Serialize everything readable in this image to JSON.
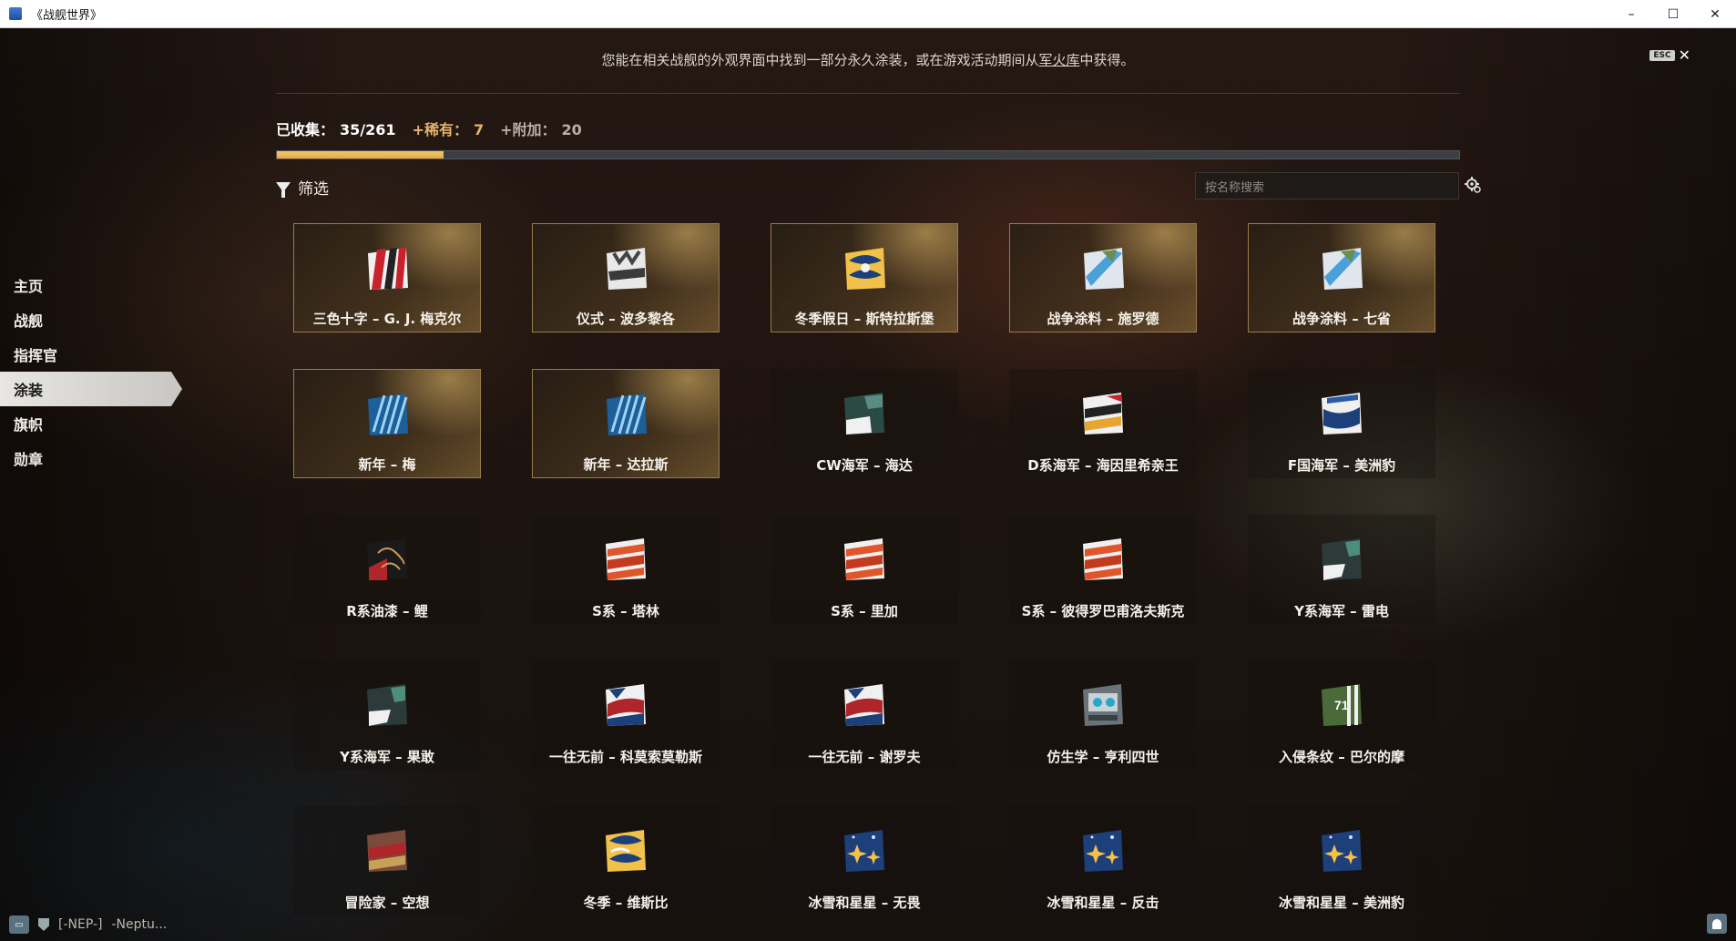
{
  "window": {
    "title": "《战舰世界》",
    "minimize": "–",
    "maximize": "☐",
    "close": "✕"
  },
  "header": {
    "esc_key": "ESC",
    "close_glyph": "✕",
    "info_prefix": "您能在相关战舰的外观界面中找到一部分永久涂装，或在游戏活动期间从",
    "info_link": "军火库",
    "info_suffix": "中获得。"
  },
  "stats": {
    "collected_label": "已收集：",
    "collected_value": "35/261",
    "rare_label": "+稀有：",
    "rare_value": "7",
    "extra_label": "+附加：",
    "extra_value": "20",
    "progress_fraction": 0.141
  },
  "filter": {
    "label": "筛选"
  },
  "search": {
    "placeholder": "按名称搜索"
  },
  "sidebar": {
    "items": [
      {
        "label": "主页"
      },
      {
        "label": "战舰"
      },
      {
        "label": "指挥官"
      },
      {
        "label": "涂装",
        "active": true
      },
      {
        "label": "旗帜"
      },
      {
        "label": "勋章"
      }
    ]
  },
  "camos": [
    {
      "name": "三色十字 – G. J. 梅克尔",
      "rare": true,
      "icon": "tricolor-cross-icon"
    },
    {
      "name": "仪式 – 波多黎各",
      "rare": true,
      "icon": "ceremony-icon"
    },
    {
      "name": "冬季假日 – 斯特拉斯堡",
      "rare": true,
      "icon": "winter-holiday-icon"
    },
    {
      "name": "战争涂料 – 施罗德",
      "rare": true,
      "icon": "war-paint-icon"
    },
    {
      "name": "战争涂料 – 七省",
      "rare": true,
      "icon": "war-paint-icon"
    },
    {
      "name": "新年 – 梅",
      "rare": true,
      "icon": "new-year-icon"
    },
    {
      "name": "新年 – 达拉斯",
      "rare": true,
      "icon": "new-year-icon"
    },
    {
      "name": "CW海军 – 海达",
      "rare": false,
      "icon": "cw-navy-icon"
    },
    {
      "name": "D系海军 – 海因里希亲王",
      "rare": false,
      "icon": "d-navy-icon"
    },
    {
      "name": "F国海军 – 美洲豹",
      "rare": false,
      "icon": "f-navy-icon"
    },
    {
      "name": "R系油漆 – 鲤",
      "rare": false,
      "icon": "r-paint-icon"
    },
    {
      "name": "S系 – 塔林",
      "rare": false,
      "icon": "s-series-icon"
    },
    {
      "name": "S系 – 里加",
      "rare": false,
      "icon": "s-series-icon"
    },
    {
      "name": "S系 – 彼得罗巴甫洛夫斯克",
      "rare": false,
      "icon": "s-series-icon"
    },
    {
      "name": "Y系海军 – 雷电",
      "rare": false,
      "icon": "y-navy-icon"
    },
    {
      "name": "Y系海军 – 果敢",
      "rare": false,
      "icon": "y-navy-icon"
    },
    {
      "name": "一往无前 – 科莫索莫勒斯",
      "rare": false,
      "icon": "forward-icon"
    },
    {
      "name": "一往无前 – 谢罗夫",
      "rare": false,
      "icon": "forward-icon"
    },
    {
      "name": "仿生学 – 亨利四世",
      "rare": false,
      "icon": "bionics-icon"
    },
    {
      "name": "入侵条纹 – 巴尔的摩",
      "rare": false,
      "icon": "invasion-stripes-icon",
      "badge": "71"
    },
    {
      "name": "冒险家 – 空想",
      "rare": false,
      "icon": "adventurer-icon"
    },
    {
      "name": "冬季 – 维斯比",
      "rare": false,
      "icon": "winter-icon"
    },
    {
      "name": "冰雪和星星 – 无畏",
      "rare": false,
      "icon": "ice-stars-icon"
    },
    {
      "name": "冰雪和星星 – 反击",
      "rare": false,
      "icon": "ice-stars-icon"
    },
    {
      "name": "冰雪和星星 – 美洲豹",
      "rare": false,
      "icon": "ice-stars-icon"
    }
  ],
  "footer": {
    "chat_icon": "chat-icon",
    "clan_text": "[-NEP-]",
    "player_text": "-Neptu..."
  },
  "colors": {
    "accent_gold": "#e4b46a",
    "progress_fill": "#f3c56e",
    "progress_track": "#3a3f44"
  }
}
